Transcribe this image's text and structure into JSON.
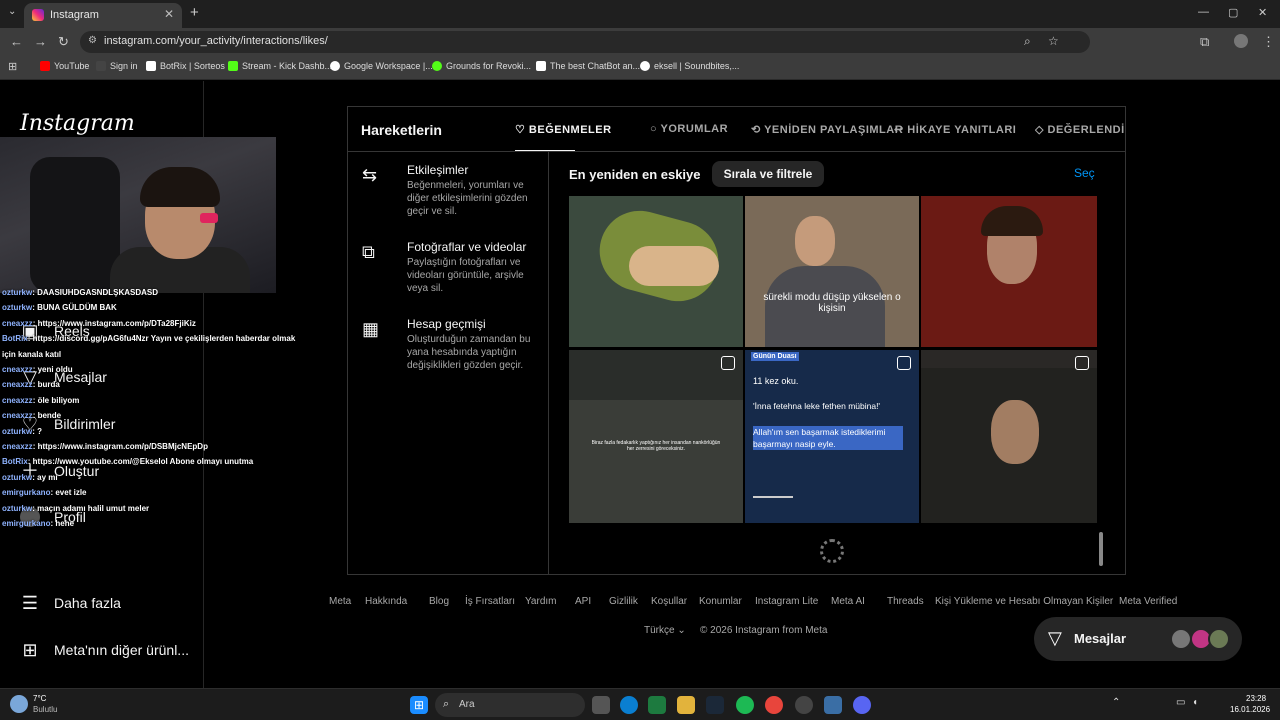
{
  "browser": {
    "tab_title": "Instagram",
    "tab_close": "✕",
    "new_tab": "+",
    "url": "instagram.com/your_activity/interactions/likes/",
    "window_controls": [
      "—",
      "▢",
      "✕"
    ],
    "bookmarks": [
      {
        "label": "YouTube",
        "color": "#ff0000"
      },
      {
        "label": "Sign in",
        "color": "#444444"
      },
      {
        "label": "BotRix | Sorteos",
        "color": "#ffffff"
      },
      {
        "label": "Stream - Kick Dashb...",
        "color": "#53fc18"
      },
      {
        "label": "Google Workspace |...",
        "color": "#ffffff"
      },
      {
        "label": "Grounds for Revoki...",
        "color": "#53fc18"
      },
      {
        "label": "The best ChatBot an...",
        "color": "#ffffff"
      },
      {
        "label": "eksell | Soundbites,...",
        "color": "#ffffff"
      }
    ]
  },
  "sidebar": {
    "logo": "Instagram",
    "items": [
      {
        "label": "Reels",
        "icon": "reels-icon"
      },
      {
        "label": "Mesajlar",
        "icon": "messenger-icon"
      },
      {
        "label": "Bildirimler",
        "icon": "heart-icon"
      },
      {
        "label": "Oluştur",
        "icon": "plus-icon"
      },
      {
        "label": "Profil",
        "icon": "avatar-icon"
      },
      {
        "label": "Daha fazla",
        "icon": "menu-icon"
      },
      {
        "label": "Meta'nın diğer ürünl...",
        "icon": "grid-icon"
      }
    ]
  },
  "chat": [
    {
      "user": "ozturkw",
      "msg": ": DAASIUHDGASNDLŞKASDASD"
    },
    {
      "user": "ozturkw",
      "msg": ": BUNA GÜLDÜM BAK"
    },
    {
      "user": "cneaxzz",
      "msg": ": https://www.instagram.com/p/DTa28FjiKiz"
    },
    {
      "user": "BotRix",
      "msg": ": https://discord.gg/pAG6fu4Nzr Yayın ve çekilişlerden haberdar olmak"
    },
    {
      "user": "",
      "msg": "için kanala katıl"
    },
    {
      "user": "cneaxzz",
      "msg": ": yeni oldu"
    },
    {
      "user": "cneaxzz",
      "msg": ": burda"
    },
    {
      "user": "cneaxzz",
      "msg": ": öle biliyom"
    },
    {
      "user": "cneaxzz",
      "msg": ": bende"
    },
    {
      "user": "ozturkw",
      "msg": ": ?"
    },
    {
      "user": "cneaxzz",
      "msg": ": https://www.instagram.com/p/DSBMjcNEpDp"
    },
    {
      "user": "BotRix",
      "msg": ": https://www.youtube.com/@Ekselol Abone olmayı unutma"
    },
    {
      "user": "ozturkw",
      "msg": ": ay mı"
    },
    {
      "user": "emirgurkano",
      "msg": ": evet izle"
    },
    {
      "user": "ozturkw",
      "msg": ": maçın adamı halil umut meler"
    },
    {
      "user": "emirgurkano",
      "msg": ": hehe"
    }
  ],
  "panel": {
    "title": "Hareketlerin",
    "tabs": [
      {
        "label": "BEĞENMELER",
        "icon": "heart-icon",
        "active": true
      },
      {
        "label": "YORUMLAR",
        "icon": "comment-icon",
        "active": false
      },
      {
        "label": "YENİDEN PAYLAŞIMLAR",
        "icon": "repost-icon",
        "active": false
      },
      {
        "label": "HİKAYE YANITLARI",
        "icon": "reply-icon",
        "active": false
      },
      {
        "label": "DEĞERLENDİR",
        "icon": "tag-icon",
        "active": false
      }
    ],
    "menu": [
      {
        "title": "Etkileşimler",
        "desc": "Beğenmeleri, yorumları ve diğer etkileşimlerini gözden geçir ve sil.",
        "icon": "arrows-icon"
      },
      {
        "title": "Fotoğraflar ve videolar",
        "desc": "Paylaştığın fotoğrafları ve videoları görüntüle, arşivle veya sil.",
        "icon": "media-icon"
      },
      {
        "title": "Hesap geçmişi",
        "desc": "Oluşturduğun zamandan bu yana hesabında yaptığın değişiklikleri gözden geçir.",
        "icon": "calendar-icon"
      }
    ],
    "sort_label": "En yeniden en eskiye",
    "sort_button": "Sırala ve filtrele",
    "select_link": "Seç",
    "thumbs": [
      {
        "caption": "",
        "bg": "#3b4a3e"
      },
      {
        "caption": "sürekli modu düşüp yükselen o kişisin",
        "bg": "#7a6a58"
      },
      {
        "caption": "",
        "bg": "#6b1a14"
      },
      {
        "caption": "Biraz fazla fedakarlık yaptığınız her insandan nankörlüğün her zerresini göreceksiniz.",
        "bg": "#2a2d2a"
      },
      {
        "caption": "",
        "bg": "#162a4a"
      },
      {
        "caption": "",
        "bg": "#2a2826"
      }
    ],
    "dua": {
      "header": "Günün Duası",
      "line1": "11 kez oku.",
      "line2": "'İnna fetehna leke fethen mübina!'",
      "line3": "Allah'ım sen başarmak istediklerimi başarmayı nasip eyle."
    }
  },
  "footer": {
    "links": [
      "Meta",
      "Hakkında",
      "Blog",
      "İş Fırsatları",
      "Yardım",
      "API",
      "Gizlilik",
      "Koşullar",
      "Konumlar",
      "Instagram Lite",
      "Meta AI",
      "Threads",
      "Kişi Yükleme ve Hesabı Olmayan Kişiler",
      "Meta Verified"
    ],
    "language": "Türkçe",
    "copyright": "© 2026 Instagram from Meta"
  },
  "messages_button": "Mesajlar",
  "taskbar": {
    "weather_temp": "7°C",
    "weather_desc": "Bulutlu",
    "search": "Ara",
    "time": "23:28",
    "date": "16.01.2026"
  }
}
